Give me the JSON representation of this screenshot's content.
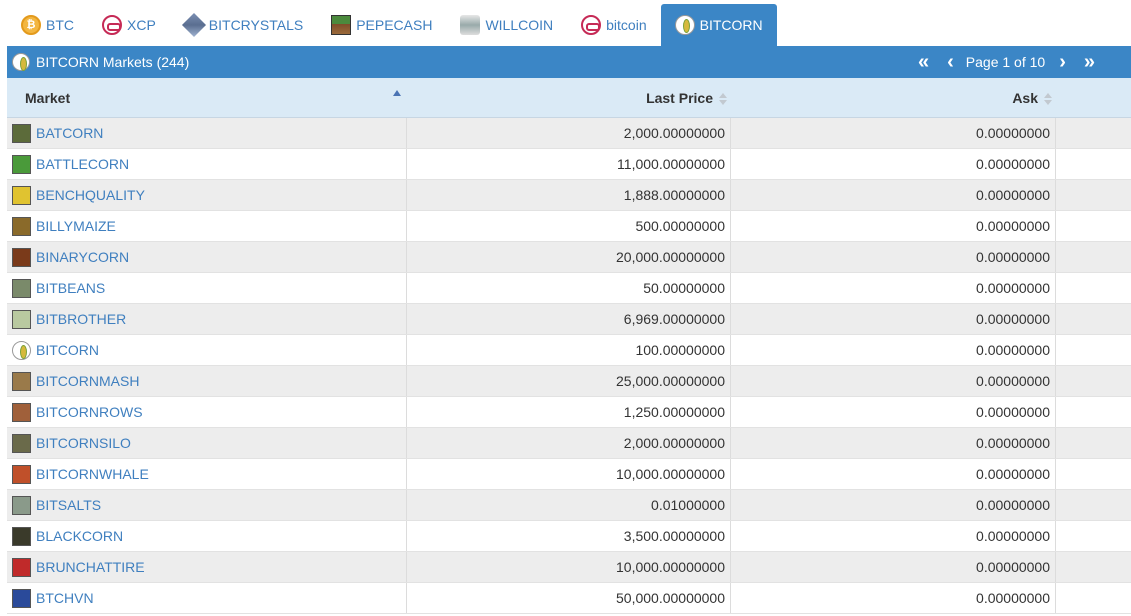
{
  "tabs": [
    {
      "label": "BTC",
      "icon": "btc-coin-icon"
    },
    {
      "label": "XCP",
      "icon": "xcp-logo-icon"
    },
    {
      "label": "BITCRYSTALS",
      "icon": "bitcrystals-icon"
    },
    {
      "label": "PEPECASH",
      "icon": "pepecash-icon"
    },
    {
      "label": "WILLCOIN",
      "icon": "willcoin-icon"
    },
    {
      "label": "bitcoin",
      "icon": "bitcoin-xcp-icon"
    },
    {
      "label": "BITCORN",
      "icon": "bitcorn-icon",
      "active": true
    }
  ],
  "panel": {
    "title": "BITCORN Markets (244)",
    "pager": {
      "label": "Page 1 of 10"
    }
  },
  "columns": {
    "market": "Market",
    "last_price": "Last Price",
    "ask": "Ask"
  },
  "rows": [
    {
      "market": "BATCORN",
      "last_price": "2,000.00000000",
      "ask": "0.00000000",
      "icon_color": "#5c6b3a"
    },
    {
      "market": "BATTLECORN",
      "last_price": "11,000.00000000",
      "ask": "0.00000000",
      "icon_color": "#4a9a3a"
    },
    {
      "market": "BENCHQUALITY",
      "last_price": "1,888.00000000",
      "ask": "0.00000000",
      "icon_color": "#e0c330"
    },
    {
      "market": "BILLYMAIZE",
      "last_price": "500.00000000",
      "ask": "0.00000000",
      "icon_color": "#8a6a2a"
    },
    {
      "market": "BINARYCORN",
      "last_price": "20,000.00000000",
      "ask": "0.00000000",
      "icon_color": "#7a3a1a"
    },
    {
      "market": "BITBEANS",
      "last_price": "50.00000000",
      "ask": "0.00000000",
      "icon_color": "#7a8a6a"
    },
    {
      "market": "BITBROTHER",
      "last_price": "6,969.00000000",
      "ask": "0.00000000",
      "icon_color": "#b9c9a0"
    },
    {
      "market": "BITCORN",
      "last_price": "100.00000000",
      "ask": "0.00000000",
      "icon_color": "#ffffff"
    },
    {
      "market": "BITCORNMASH",
      "last_price": "25,000.00000000",
      "ask": "0.00000000",
      "icon_color": "#9a7a4a"
    },
    {
      "market": "BITCORNROWS",
      "last_price": "1,250.00000000",
      "ask": "0.00000000",
      "icon_color": "#a0603a"
    },
    {
      "market": "BITCORNSILO",
      "last_price": "2,000.00000000",
      "ask": "0.00000000",
      "icon_color": "#6a6a4a"
    },
    {
      "market": "BITCORNWHALE",
      "last_price": "10,000.00000000",
      "ask": "0.00000000",
      "icon_color": "#c0502a"
    },
    {
      "market": "BITSALTS",
      "last_price": "0.01000000",
      "ask": "0.00000000",
      "icon_color": "#8a9a8a"
    },
    {
      "market": "BLACKCORN",
      "last_price": "3,500.00000000",
      "ask": "0.00000000",
      "icon_color": "#3a3a2a"
    },
    {
      "market": "BRUNCHATTIRE",
      "last_price": "10,000.00000000",
      "ask": "0.00000000",
      "icon_color": "#c02a2a"
    },
    {
      "market": "BTCHVN",
      "last_price": "50,000.00000000",
      "ask": "0.00000000",
      "icon_color": "#2a4a9a"
    }
  ]
}
